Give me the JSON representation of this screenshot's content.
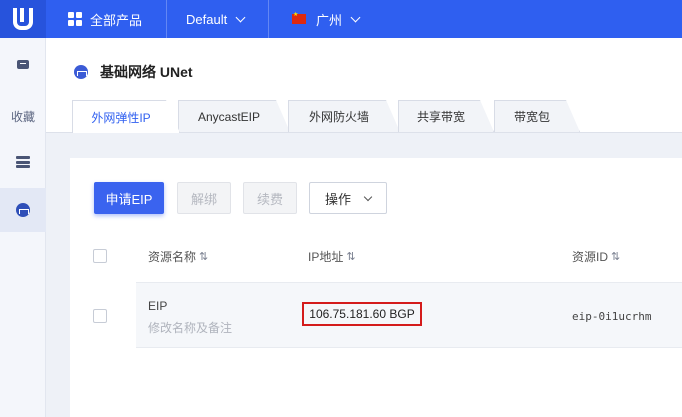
{
  "topbar": {
    "all_products": "全部产品",
    "project": "Default",
    "region": "广州"
  },
  "sidebar": {
    "favorites_label": "收藏"
  },
  "page": {
    "title": "基础网络 UNet"
  },
  "tabs": [
    {
      "label": "外网弹性IP"
    },
    {
      "label": "AnycastEIP"
    },
    {
      "label": "外网防火墙"
    },
    {
      "label": "共享带宽"
    },
    {
      "label": "带宽包"
    }
  ],
  "toolbar": {
    "apply_eip": "申请EIP",
    "unbind": "解绑",
    "renew": "续费",
    "actions": "操作"
  },
  "table": {
    "headers": [
      "资源名称",
      "IP地址",
      "资源ID"
    ],
    "sort_glyph": "⇅",
    "rows": [
      {
        "name": "EIP",
        "name_hint": "修改名称及备注",
        "ip": "106.75.181.60 BGP",
        "resource_id": "eip-0i1ucrhm"
      }
    ]
  }
}
